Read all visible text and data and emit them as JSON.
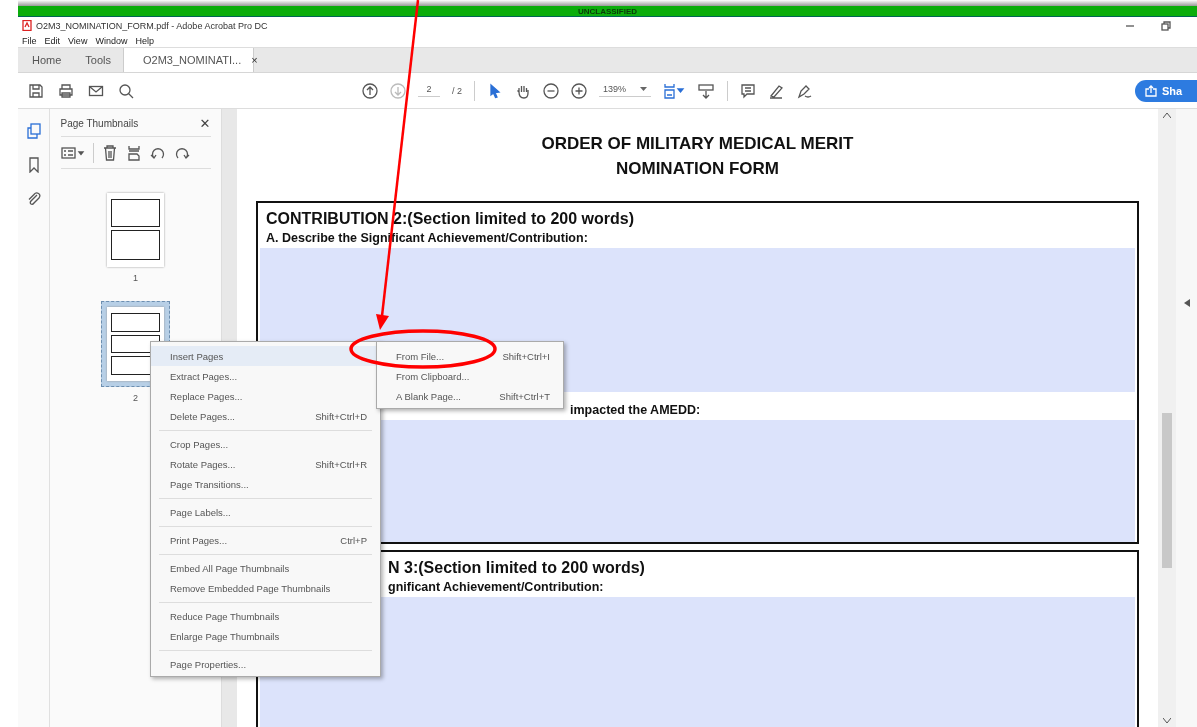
{
  "classification_banner": "UNCLASSIFIED",
  "window": {
    "title": "O2M3_NOMINATION_FORM.pdf - Adobe Acrobat Pro DC"
  },
  "menu_bar": [
    "File",
    "Edit",
    "View",
    "Window",
    "Help"
  ],
  "tabs": [
    {
      "label": "Home",
      "selected": false,
      "kind": "nav"
    },
    {
      "label": "Tools",
      "selected": false,
      "kind": "nav"
    },
    {
      "label": "O2M3_NOMINATI...",
      "selected": true,
      "kind": "document",
      "close": "×"
    }
  ],
  "toolbar": {
    "page_current": "2",
    "page_total": "/ 2",
    "zoom": "139%",
    "share_label": "Sha"
  },
  "thumbnails_panel": {
    "title": "Page Thumbnails",
    "close": "✕",
    "pages": [
      {
        "label": "1",
        "selected": false
      },
      {
        "label": "2",
        "selected": true
      }
    ]
  },
  "document": {
    "title_lines": [
      "ORDER OF MILITARY MEDICAL MERIT",
      "NOMINATION FORM"
    ],
    "sections": [
      {
        "heading": "CONTRIBUTION 2:(Section limited to 200 words)",
        "fields": [
          {
            "label": "A. Describe the Significant Achievement/Contribution:"
          },
          {
            "label": "impacted the AMEDD:"
          }
        ]
      },
      {
        "heading": "N 3:(Section limited to 200 words)",
        "fields": [
          {
            "label": "gnificant Achievement/Contribution:"
          }
        ]
      }
    ]
  },
  "context_menu": {
    "groups": [
      [
        {
          "label": "Insert Pages",
          "selected": true
        },
        {
          "label": "Extract Pages...",
          "selected": false
        },
        {
          "label": "Replace Pages...",
          "selected": false
        },
        {
          "label": "Delete Pages...",
          "shortcut": "Shift+Ctrl+D",
          "selected": false
        }
      ],
      [
        {
          "label": "Crop Pages...",
          "selected": false
        },
        {
          "label": "Rotate Pages...",
          "shortcut": "Shift+Ctrl+R",
          "selected": false
        },
        {
          "label": "Page Transitions...",
          "selected": false
        }
      ],
      [
        {
          "label": "Page Labels...",
          "selected": false
        }
      ],
      [
        {
          "label": "Print Pages...",
          "shortcut": "Ctrl+P",
          "selected": false
        }
      ],
      [
        {
          "label": "Embed All Page Thumbnails",
          "selected": false
        },
        {
          "label": "Remove Embedded Page Thumbnails",
          "selected": false
        }
      ],
      [
        {
          "label": "Reduce Page Thumbnails",
          "selected": false
        },
        {
          "label": "Enlarge Page Thumbnails",
          "selected": false
        }
      ],
      [
        {
          "label": "Page Properties...",
          "selected": false
        }
      ]
    ]
  },
  "submenu": [
    {
      "label": "From File...",
      "shortcut": "Shift+Ctrl+I"
    },
    {
      "label": "From Clipboard..."
    },
    {
      "label": "A Blank Page...",
      "shortcut": "Shift+Ctrl+T"
    }
  ]
}
